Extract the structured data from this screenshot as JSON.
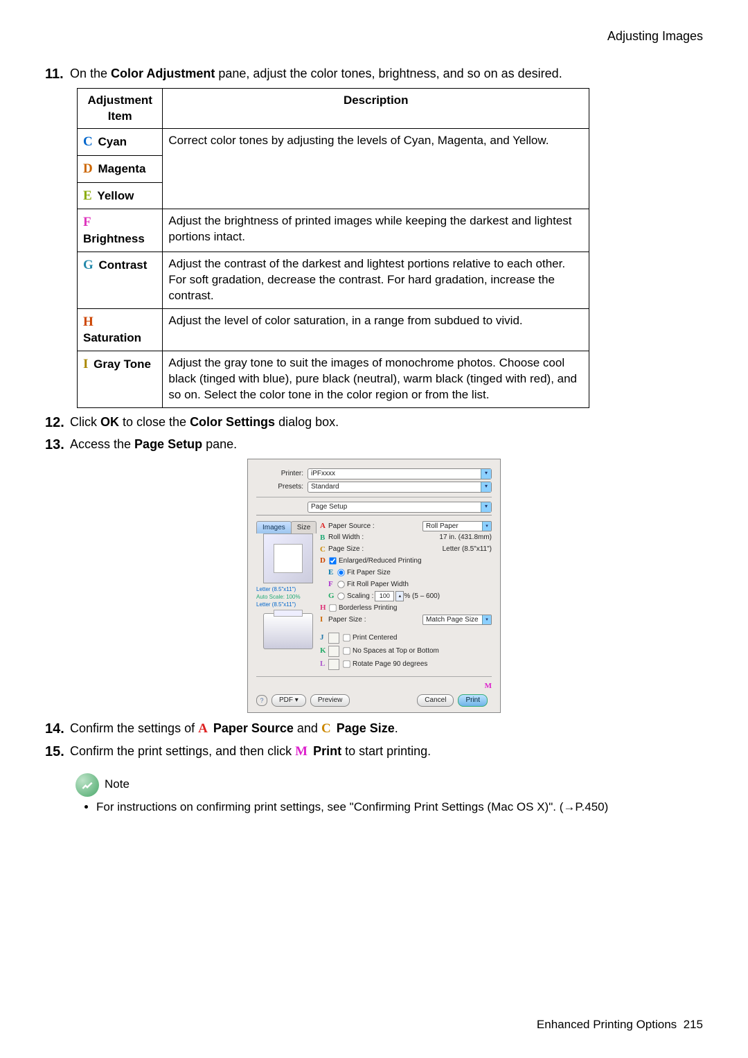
{
  "header": "Adjusting Images",
  "step11": {
    "num": "11.",
    "lead": "On the ",
    "b1": "Color Adjustment",
    "tail": " pane, adjust the color tones, brightness, and so on as desired."
  },
  "table": {
    "th1": "Adjustment Item",
    "th2": "Description",
    "r1": {
      "l": "C",
      "name": "Cyan"
    },
    "r2": {
      "l": "D",
      "name": "Magenta"
    },
    "r3": {
      "l": "E",
      "name": "Yellow"
    },
    "d1": "Correct color tones by adjusting the levels of Cyan, Magenta, and Yellow.",
    "r4": {
      "l": "F",
      "name": "Brightness",
      "d": "Adjust the brightness of printed images while keeping the darkest and lightest portions intact."
    },
    "r5": {
      "l": "G",
      "name": "Contrast",
      "d": "Adjust the contrast of the darkest and lightest portions relative to each other.\nFor soft gradation, decrease the contrast. For hard gradation, increase the contrast."
    },
    "r6": {
      "l": "H",
      "name": "Saturation",
      "d": "Adjust the level of color saturation, in a range from subdued to vivid."
    },
    "r7": {
      "l": "I",
      "name": "Gray Tone",
      "d": "Adjust the gray tone to suit the images of monochrome photos. Choose cool black (tinged with blue), pure black (neutral), warm black (tinged with red), and so on. Select the color tone in the color region or from the list."
    }
  },
  "step12": {
    "num": "12.",
    "a": "Click ",
    "b1": "OK",
    "b": " to close the ",
    "b2": "Color Settings",
    "c": " dialog box."
  },
  "step13": {
    "num": "13.",
    "a": "Access the ",
    "b1": "Page Setup",
    "b": " pane."
  },
  "dlg": {
    "printer_l": "Printer:",
    "printer_v": "iPFxxxx",
    "presets_l": "Presets:",
    "presets_v": "Standard",
    "pane": "Page Setup",
    "tab1": "Images",
    "tab2": "Size",
    "left1": "Letter (8.5\"x11\")",
    "left2": "Auto Scale: 100%",
    "left3": "Letter (8.5\"x11\")",
    "A": {
      "l": "A",
      "t": "Paper Source :",
      "v": "Roll Paper"
    },
    "B": {
      "l": "B",
      "t": "Roll Width :",
      "v": "17 in. (431.8mm)"
    },
    "C": {
      "l": "C",
      "t": "Page Size :",
      "v": "Letter (8.5\"x11\")"
    },
    "D": {
      "l": "D",
      "t": "Enlarged/Reduced Printing"
    },
    "E": {
      "l": "E",
      "t": "Fit Paper Size"
    },
    "F": {
      "l": "F",
      "t": "Fit Roll Paper Width"
    },
    "G": {
      "l": "G",
      "t": "Scaling :",
      "v": "100",
      "suffix": "% (5 – 600)"
    },
    "H": {
      "l": "H",
      "t": "Borderless Printing"
    },
    "I": {
      "l": "I",
      "t": "Paper Size :",
      "v": "Match Page Size"
    },
    "J": {
      "l": "J",
      "t": "Print Centered"
    },
    "K": {
      "l": "K",
      "t": "No Spaces at Top or Bottom"
    },
    "L": {
      "l": "L",
      "t": "Rotate Page 90 degrees"
    },
    "M": {
      "l": "M"
    },
    "q": "?",
    "pdf": "PDF ▾",
    "preview": "Preview",
    "cancel": "Cancel",
    "print": "Print"
  },
  "step14": {
    "num": "14.",
    "a": "Confirm the settings of ",
    "lA": "A",
    "b1": "Paper Source",
    "b": " and ",
    "lC": "C",
    "b2": "Page Size",
    "c": "."
  },
  "step15": {
    "num": "15.",
    "a": "Confirm the print settings, and then click ",
    "lM": "M",
    "b1": "Print",
    "b": " to start printing."
  },
  "note": {
    "title": "Note",
    "li": "For instructions on confirming print settings, see \"Confirming Print Settings (Mac OS X)\". (→P.450)"
  },
  "footer": {
    "t": "Enhanced Printing Options",
    "p": "215"
  }
}
